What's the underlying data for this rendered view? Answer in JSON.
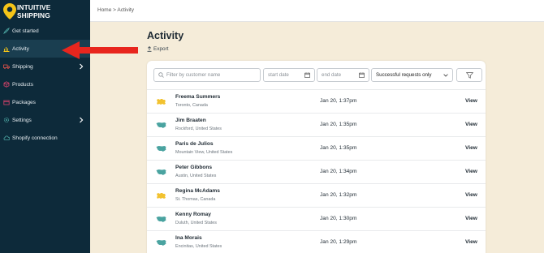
{
  "brand": {
    "line1": "INTUITIVE",
    "line2": "SHIPPING"
  },
  "nav": [
    {
      "label": "Get started",
      "icon": "rocket-icon"
    },
    {
      "label": "Activity",
      "icon": "activity-icon"
    },
    {
      "label": "Shipping",
      "icon": "truck-icon"
    },
    {
      "label": "Products",
      "icon": "box-icon"
    },
    {
      "label": "Packages",
      "icon": "package-icon"
    },
    {
      "label": "Settings",
      "icon": "gear-icon"
    },
    {
      "label": "Shopify connection",
      "icon": "cloud-icon"
    }
  ],
  "breadcrumb": "Home > Activity",
  "page": {
    "title": "Activity",
    "export_label": "Export"
  },
  "filters": {
    "search_placeholder": "Filter by customer name",
    "start_placeholder": "start date",
    "end_placeholder": "end date",
    "status_value": "Successful requests only"
  },
  "rows": [
    {
      "name": "Freema Summers",
      "location": "Toronto, Canada",
      "date": "Jan 20, 1:37pm",
      "action": "View",
      "flag": "canada"
    },
    {
      "name": "Jim Braaten",
      "location": "Rockford, United States",
      "date": "Jan 20, 1:35pm",
      "action": "View",
      "flag": "usa"
    },
    {
      "name": "Paris de Julios",
      "location": "Mountain View, United States",
      "date": "Jan 20, 1:35pm",
      "action": "View",
      "flag": "usa"
    },
    {
      "name": "Peter Gibbons",
      "location": "Austin, United States",
      "date": "Jan 20, 1:34pm",
      "action": "View",
      "flag": "usa"
    },
    {
      "name": "Regina McAdams",
      "location": "St. Thomas, Canada",
      "date": "Jan 20, 1:32pm",
      "action": "View",
      "flag": "canada"
    },
    {
      "name": "Kenny Romay",
      "location": "Duluth, United States",
      "date": "Jan 20, 1:30pm",
      "action": "View",
      "flag": "usa"
    },
    {
      "name": "Ina Morais",
      "location": "Encinitas, United States",
      "date": "Jan 20, 1:29pm",
      "action": "View",
      "flag": "usa"
    }
  ],
  "colors": {
    "sidebar": "#0d2a3a",
    "accent": "#f5c518",
    "background": "#f5ecd9",
    "canada_icon": "#f2c230",
    "usa_icon": "#4aa3a0",
    "arrow": "#e8261e"
  }
}
